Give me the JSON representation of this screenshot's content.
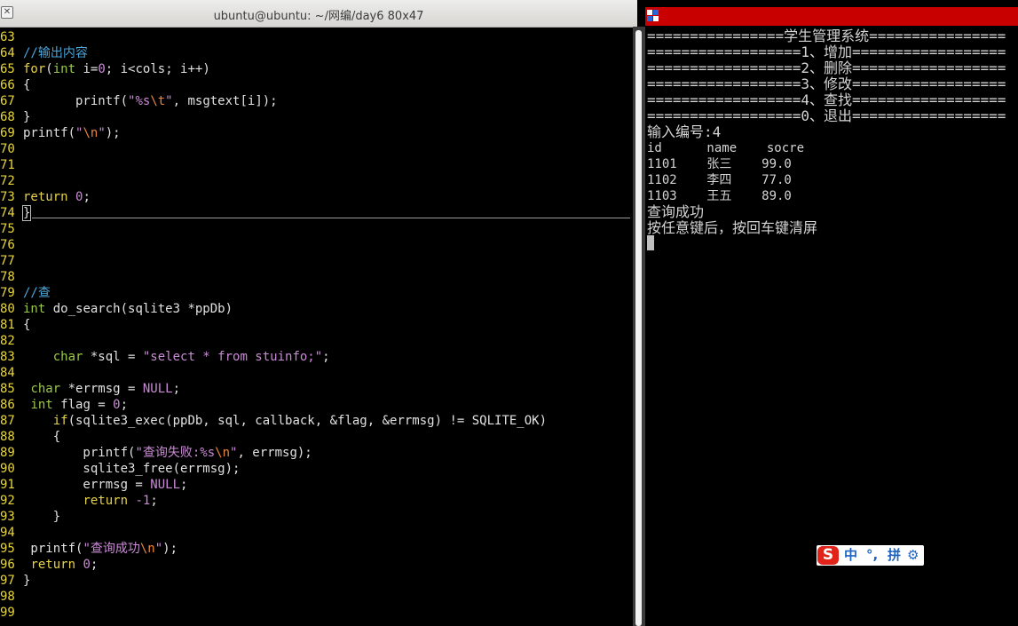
{
  "left_window": {
    "title": "ubuntu@ubuntu: ~/网编/day6 80x47",
    "close_glyph": "✕"
  },
  "editor": {
    "lines": [
      {
        "n": "63",
        "code": ""
      },
      {
        "n": "64",
        "code": "<span class='cm'>//输出内容</span>"
      },
      {
        "n": "65",
        "code": "<span class='kw'>for</span>(<span class='ty'>int</span> i=<span class='num'>0</span>; i&lt;cols; i++)"
      },
      {
        "n": "66",
        "code": "{"
      },
      {
        "n": "67",
        "code": "       printf(<span class='str'>\"%s</span><span class='esc'>\\t</span><span class='str'>\"</span>, msgtext[i]);"
      },
      {
        "n": "68",
        "code": "}"
      },
      {
        "n": "69",
        "code": "printf(<span class='str'>\"</span><span class='esc'>\\n</span><span class='str'>\"</span>);"
      },
      {
        "n": "70",
        "code": ""
      },
      {
        "n": "71",
        "code": ""
      },
      {
        "n": "72",
        "code": ""
      },
      {
        "n": "73",
        "code": "<span class='kw'>return</span> <span class='num'>0</span>;"
      },
      {
        "n": "74",
        "code": "<span class='cursor-box'>}</span>"
      },
      {
        "n": "75",
        "code": ""
      },
      {
        "n": "76",
        "code": ""
      },
      {
        "n": "77",
        "code": ""
      },
      {
        "n": "78",
        "code": ""
      },
      {
        "n": "79",
        "code": "<span class='cm'>//查</span>"
      },
      {
        "n": "80",
        "code": "<span class='ty'>int</span> do_search(sqlite3 *ppDb)"
      },
      {
        "n": "81",
        "code": "{"
      },
      {
        "n": "82",
        "code": ""
      },
      {
        "n": "83",
        "code": "    <span class='ty'>char</span> *sql = <span class='str'>\"select * from stuinfo;\"</span>;"
      },
      {
        "n": "84",
        "code": ""
      },
      {
        "n": "85",
        "code": " <span class='ty'>char</span> *errmsg = <span class='num'>NULL</span>;"
      },
      {
        "n": "86",
        "code": " <span class='ty'>int</span> flag = <span class='num'>0</span>;"
      },
      {
        "n": "87",
        "code": "    <span class='kw'>if</span>(sqlite3_exec(ppDb, sql, callback, &amp;flag, &amp;errmsg) != SQLITE_OK)"
      },
      {
        "n": "88",
        "code": "    {"
      },
      {
        "n": "89",
        "code": "        printf(<span class='str'>\"查询失败:%s</span><span class='esc'>\\n</span><span class='str'>\"</span>, errmsg);"
      },
      {
        "n": "90",
        "code": "        sqlite3_free(errmsg);"
      },
      {
        "n": "91",
        "code": "        errmsg = <span class='num'>NULL</span>;"
      },
      {
        "n": "92",
        "code": "        <span class='kw'>return</span> <span class='num'>-1</span>;"
      },
      {
        "n": "93",
        "code": "    }"
      },
      {
        "n": "94",
        "code": ""
      },
      {
        "n": "95",
        "code": " printf(<span class='str'>\"查询成功</span><span class='esc'>\\n</span><span class='str'>\"</span>);"
      },
      {
        "n": "96",
        "code": " <span class='kw'>return</span> <span class='num'>0</span>;"
      },
      {
        "n": "97",
        "code": "}"
      },
      {
        "n": "98",
        "code": ""
      },
      {
        "n": "99",
        "code": ""
      }
    ]
  },
  "console": {
    "menu": [
      "================学生管理系统================",
      "==================1、增加==================",
      "==================2、删除==================",
      "==================3、修改==================",
      "==================4、查找==================",
      "==================0、退出=================="
    ],
    "prompt": "输入编号:4",
    "table": [
      "id      name    socre",
      "1101    张三    99.0",
      "1102    李四    77.0",
      "1103    王五    89.0"
    ],
    "success": "查询成功",
    "hint": "按任意键后，按回车键清屏"
  },
  "ime": {
    "logo": "S",
    "lang": "中",
    "punct": "°,",
    "mode": "拼",
    "settings_glyph": "⚙"
  },
  "colors": {
    "console_titlebar": "#c90000",
    "line_numbers": "#e7d63b",
    "keyword": "#e6d24a",
    "type": "#9bc84a",
    "string": "#c98bd5",
    "escape": "#e9863d",
    "comment": "#4aa6da",
    "ime_blue": "#1e63c4",
    "ime_red": "#e2231a"
  }
}
